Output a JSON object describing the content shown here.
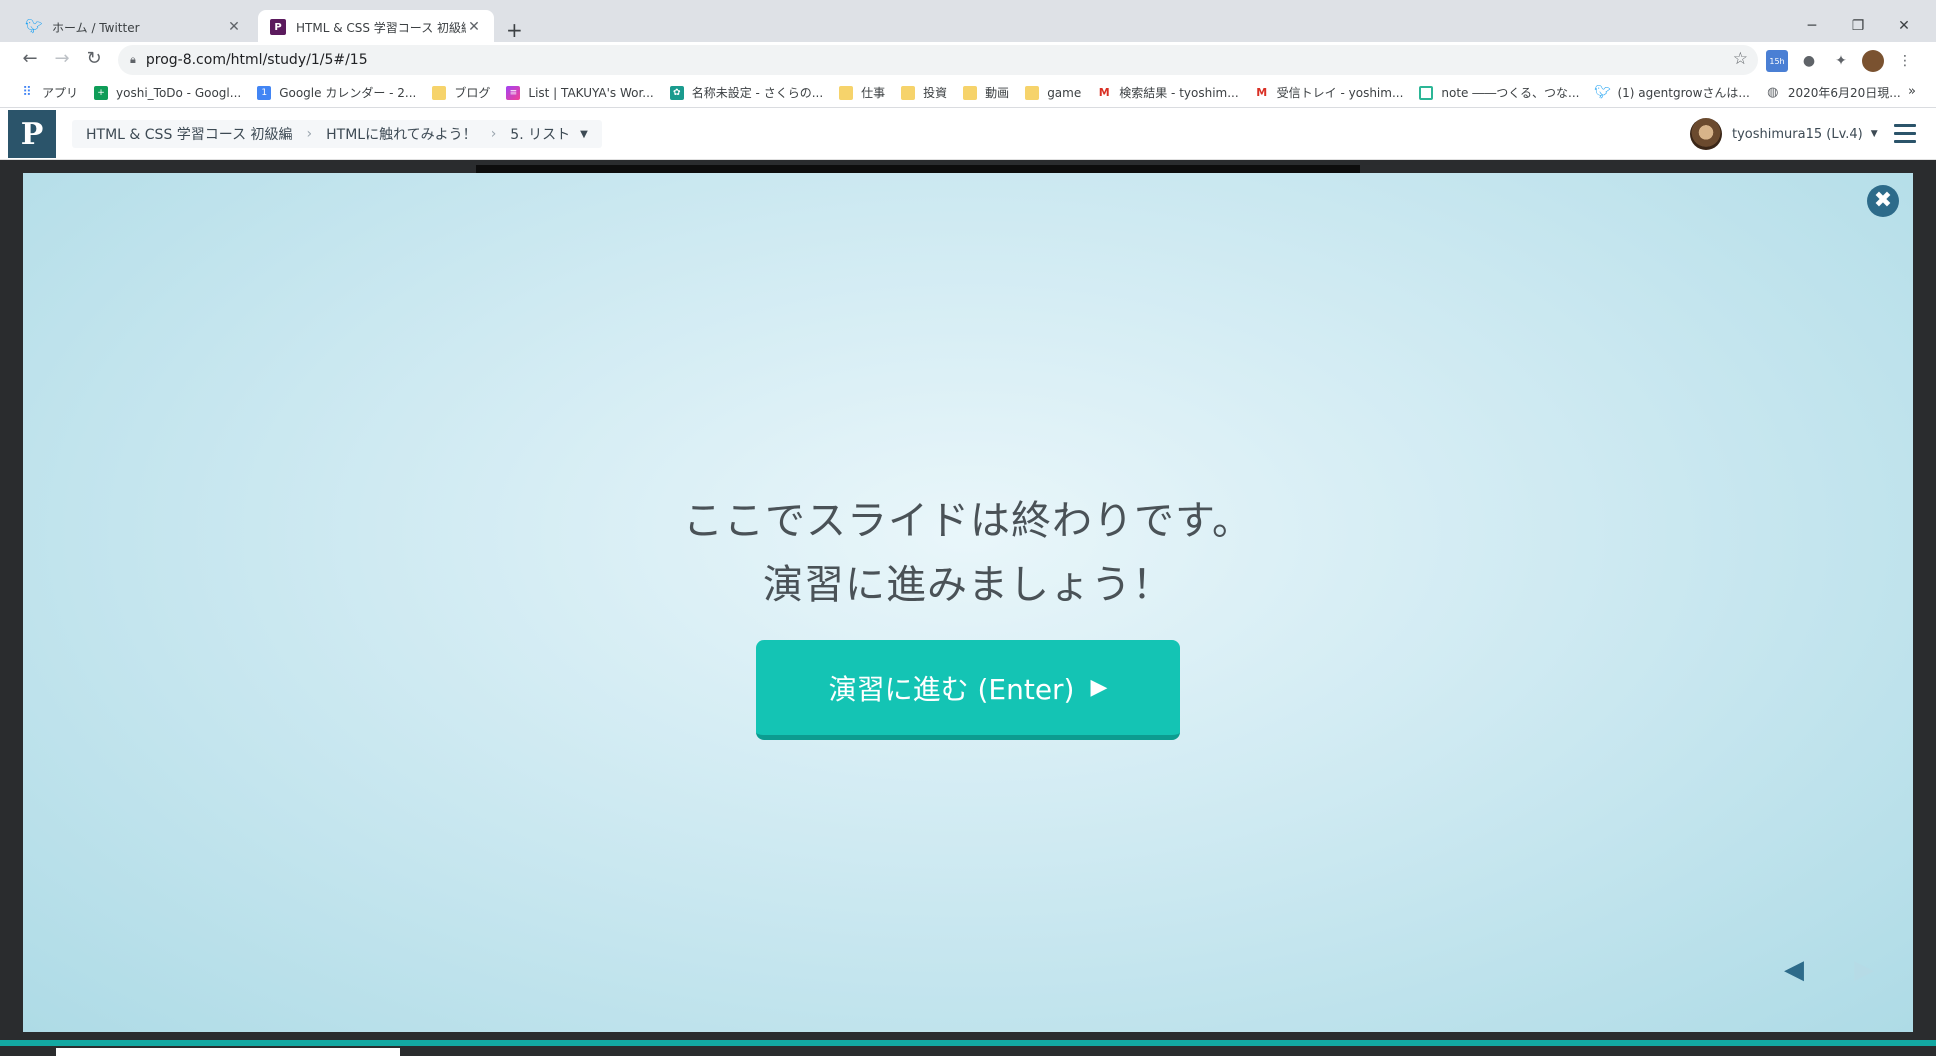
{
  "browser": {
    "tabs": [
      {
        "title": "ホーム / Twitter",
        "icon": "twitter-icon"
      },
      {
        "title": "HTML & CSS 学習コース 初級編 | ブ",
        "icon": "progate-icon"
      }
    ],
    "url": "prog-8.com/html/study/1/5#/15",
    "bookmarks": [
      {
        "label": "アプリ",
        "icon": "apps-icon"
      },
      {
        "label": "yoshi_ToDo - Googl...",
        "icon": "sheets-icon"
      },
      {
        "label": "Google カレンダー - 2...",
        "icon": "calendar-icon"
      },
      {
        "label": "ブログ",
        "icon": "folder-icon"
      },
      {
        "label": "List | TAKUYA's Wor...",
        "icon": "list-icon"
      },
      {
        "label": "名称未設定 - さくらの...",
        "icon": "sakura-icon"
      },
      {
        "label": "仕事",
        "icon": "folder-icon"
      },
      {
        "label": "投資",
        "icon": "folder-icon"
      },
      {
        "label": "動画",
        "icon": "folder-icon"
      },
      {
        "label": "game",
        "icon": "folder-icon"
      },
      {
        "label": "検索結果 - tyoshim...",
        "icon": "gmail-icon"
      },
      {
        "label": "受信トレイ - yoshim...",
        "icon": "gmail-icon"
      },
      {
        "label": "note ――つくる、つな...",
        "icon": "note-icon"
      },
      {
        "label": "(1) agentgrowさんは...",
        "icon": "twitter-icon"
      },
      {
        "label": "2020年6月20日現...",
        "icon": "globe-icon"
      }
    ],
    "extension_badge": "15h"
  },
  "header": {
    "breadcrumbs": [
      "HTML & CSS 学習コース 初級編",
      "HTMLに触れてみよう！",
      "5. リスト"
    ],
    "username": "tyoshimura15 (Lv.4)"
  },
  "slide": {
    "message_line1": "ここでスライドは終わりです。",
    "message_line2": "演習に進みましょう！",
    "button_label": "演習に進む (Enter)",
    "button_icon": "▶",
    "close_icon": "✖",
    "prev_icon": "◀",
    "next_icon": "▶"
  },
  "colors": {
    "accent": "#14c4b4",
    "brand": "#2b546a",
    "slide_bg": "#cfeaf2"
  }
}
